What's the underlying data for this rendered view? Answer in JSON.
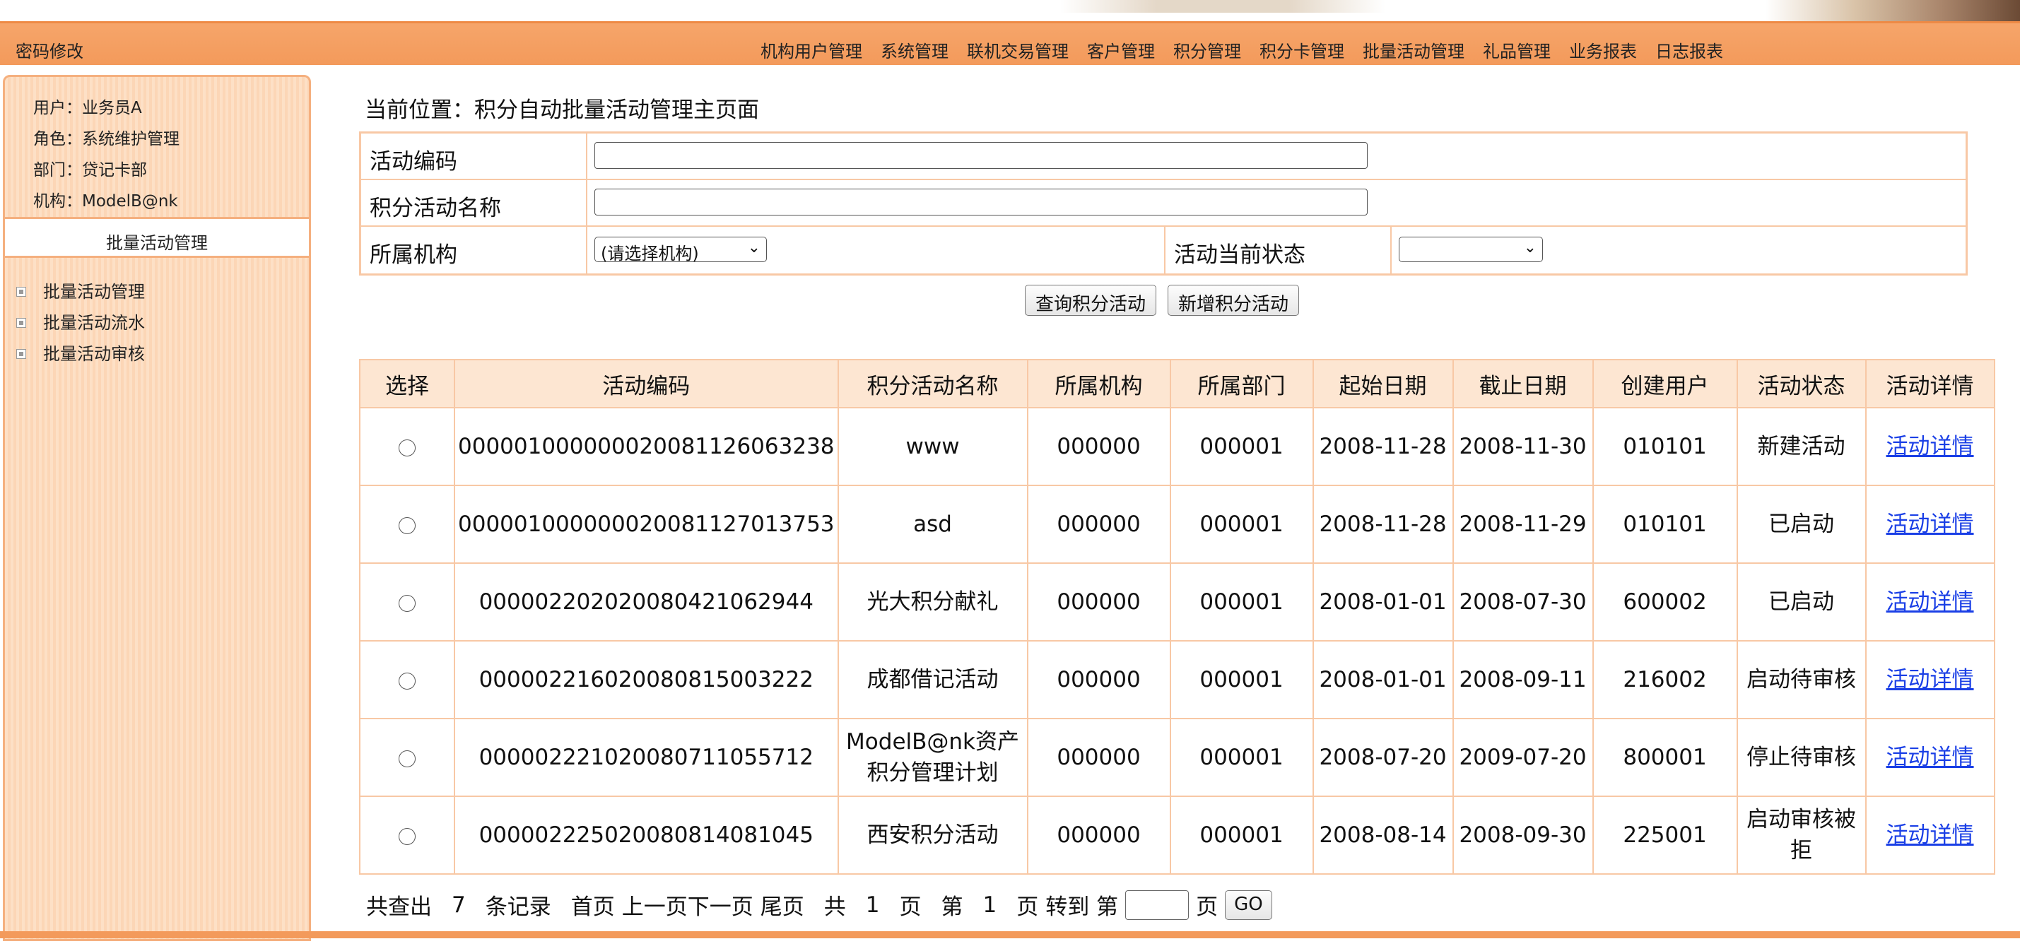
{
  "header": {
    "password_link": "密码修改",
    "nav": [
      "机构用户管理",
      "系统管理",
      "联机交易管理",
      "客户管理",
      "积分管理",
      "积分卡管理",
      "批量活动管理",
      "礼品管理",
      "业务报表",
      "日志报表"
    ]
  },
  "sidebar": {
    "user": "用户：业务员A",
    "role": "角色：系统维护管理",
    "dept": "部门：贷记卡部",
    "org": "机构：ModelB@nk",
    "title": "批量活动管理",
    "items": [
      {
        "label": "批量活动管理"
      },
      {
        "label": "批量活动流水"
      },
      {
        "label": "批量活动审核"
      }
    ]
  },
  "breadcrumb": "当前位置：积分自动批量活动管理主页面",
  "search": {
    "code_label": "活动编码",
    "code_value": "",
    "name_label": "积分活动名称",
    "name_value": "",
    "org_label": "所属机构",
    "org_selected": "(请选择机构)",
    "status_label": "活动当前状态",
    "status_selected": "",
    "query_button": "查询积分活动",
    "add_button": "新增积分活动"
  },
  "table": {
    "headers": [
      "选择",
      "活动编码",
      "积分活动名称",
      "所属机构",
      "所属部门",
      "起始日期",
      "截止日期",
      "创建用户",
      "活动状态",
      "活动详情"
    ],
    "rows": [
      {
        "code": "000001000000020081126063238",
        "name": "www",
        "org": "000000",
        "dept": "000001",
        "start": "2008-11-28",
        "end": "2008-11-30",
        "user": "010101",
        "status": "新建活动",
        "detail": "活动详情"
      },
      {
        "code": "000001000000020081127013753",
        "name": "asd",
        "org": "000000",
        "dept": "000001",
        "start": "2008-11-28",
        "end": "2008-11-29",
        "user": "010101",
        "status": "已启动",
        "detail": "活动详情"
      },
      {
        "code": "000002202020080421062944",
        "name": "光大积分献礼",
        "org": "000000",
        "dept": "000001",
        "start": "2008-01-01",
        "end": "2008-07-30",
        "user": "600002",
        "status": "已启动",
        "detail": "活动详情"
      },
      {
        "code": "000002216020080815003222",
        "name": "成都借记活动",
        "org": "000000",
        "dept": "000001",
        "start": "2008-01-01",
        "end": "2008-09-11",
        "user": "216002",
        "status": "启动待审核",
        "detail": "活动详情"
      },
      {
        "code": "000002221020080711055712",
        "name": "ModelB@nk资产积分管理计划",
        "org": "000000",
        "dept": "000001",
        "start": "2008-07-20",
        "end": "2009-07-20",
        "user": "800001",
        "status": "停止待审核",
        "detail": "活动详情"
      },
      {
        "code": "000002225020080814081045",
        "name": "西安积分活动",
        "org": "000000",
        "dept": "000001",
        "start": "2008-08-14",
        "end": "2008-09-30",
        "user": "225001",
        "status": "启动审核被拒",
        "detail": "活动详情"
      }
    ]
  },
  "pager": {
    "found_prefix": "共查出",
    "total": "7",
    "found_suffix": "条记录",
    "first": "首页",
    "prev": "上一页",
    "next": "下一页",
    "last": "尾页",
    "pages_prefix": "共",
    "pages": "1",
    "pages_suffix": "页",
    "current_prefix": "第",
    "current": "1",
    "current_suffix": "页",
    "goto_prefix": "转到 第",
    "goto_suffix": "页",
    "go_button": "GO"
  }
}
